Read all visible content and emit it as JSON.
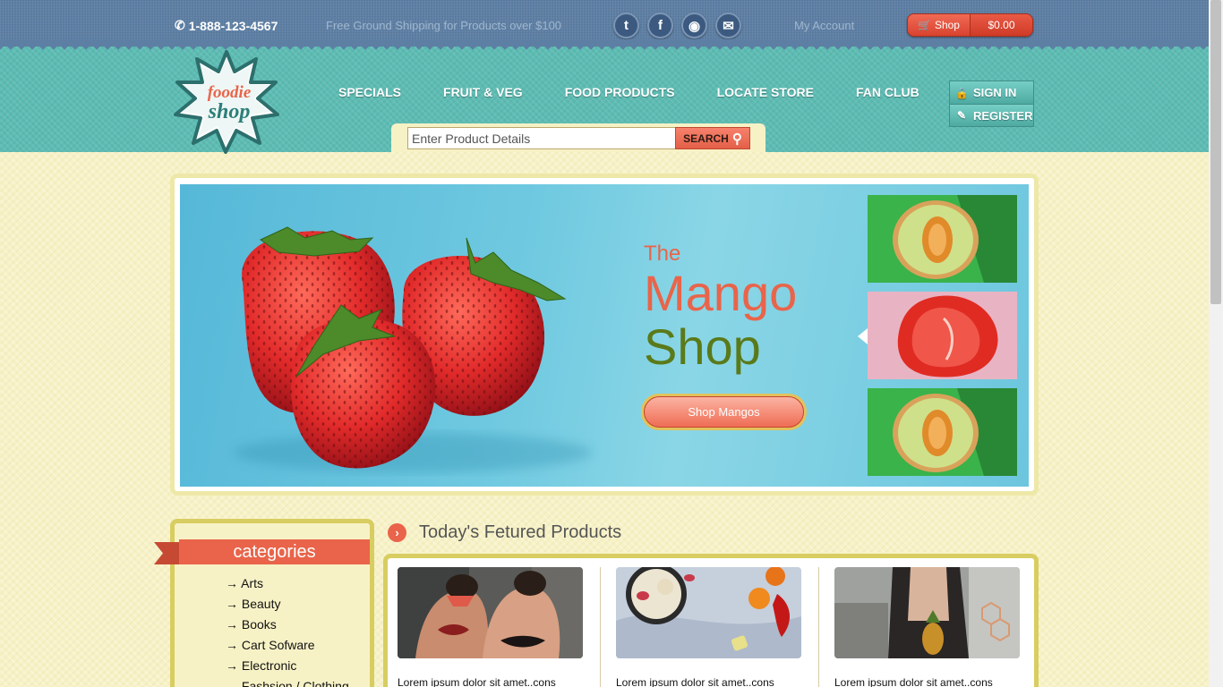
{
  "topbar": {
    "phone": "1-888-123-4567",
    "shipping": "Free Ground Shipping for Products over $100",
    "socials": [
      {
        "name": "twitter-icon",
        "glyph": "t"
      },
      {
        "name": "facebook-icon",
        "glyph": "f"
      },
      {
        "name": "rss-icon",
        "glyph": "◉"
      },
      {
        "name": "mail-icon",
        "glyph": "✉"
      }
    ],
    "account": "My Account",
    "cart_label": "Shop",
    "cart_total": "$0.00"
  },
  "header": {
    "logo_line1": "foodie",
    "logo_line2": "shop",
    "nav": [
      "SPECIALS",
      "FRUIT & VEG",
      "FOOD PRODUCTS",
      "LOCATE STORE",
      "FAN CLUB"
    ],
    "sign_in": "SIGN IN",
    "register": "REGISTER",
    "search_placeholder": "Enter Product Details",
    "search_button": "SEARCH"
  },
  "hero": {
    "the": "The",
    "title_line1": "Mango",
    "title_line2": "Shop",
    "button": "Shop Mangos",
    "colors": {
      "accent": "#e9644a",
      "green": "#5a7a1a"
    }
  },
  "sidebar": {
    "title": "categories",
    "items": [
      "→ Arts",
      "→ Beauty",
      "→ Books",
      "→ Cart Sofware",
      "→ Electronic",
      "→ Fashsion / Clothing"
    ]
  },
  "featured": {
    "title": "Today's Fetured Products",
    "products": [
      {
        "text": "Lorem ipsum dolor sit amet..cons"
      },
      {
        "text": "Lorem ipsum dolor sit amet..cons"
      },
      {
        "text": "Lorem ipsum dolor sit amet..cons"
      }
    ]
  }
}
